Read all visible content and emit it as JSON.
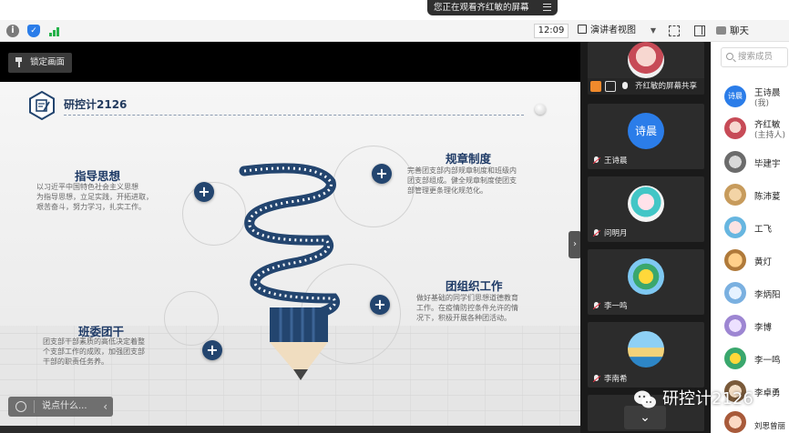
{
  "banner": {
    "viewing_text": "您正在观看齐红敏的屏幕"
  },
  "toolbar": {
    "time": "12:09",
    "view_mode": "演讲者视图",
    "chat_tab": "聊天"
  },
  "stage": {
    "lock_label": "锁定画面",
    "chat_placeholder": "说点什么..."
  },
  "slide": {
    "title": "研控计2126",
    "sections": {
      "guiding": {
        "title": "指导思想",
        "body_lines": [
          "以习近平中国特色社会主义思想",
          "为指导思想，立足实践，开拓进取，",
          "艰苦奋斗，努力学习，扎实工作。"
        ]
      },
      "rules": {
        "title": "规章制度",
        "body_lines": [
          "完善团支部内部规章制度和班级内",
          "团支部组成。健全规章制度使团支",
          "部管理更条理化规范化。"
        ]
      },
      "activities": {
        "title": "团组织工作",
        "body_lines": [
          "做好基础的同学们思想道德教育",
          "工作。在疫情防控条件允许的情",
          "况下，积极开展各种团活动。"
        ]
      },
      "committee": {
        "title": "班委团干",
        "body_lines": [
          "团支部干部素质的高低决定着整",
          "个支部工作的成败，加强团支部",
          "干部的职责任务养。"
        ]
      }
    }
  },
  "video_tiles": [
    {
      "name": "齐红敏的屏幕共享",
      "kind": "avatar-girl"
    },
    {
      "name": "王诗晨",
      "avatar_text": "诗晨",
      "kind": "text"
    },
    {
      "name": "问明月",
      "kind": "avatar-anime"
    },
    {
      "name": "李一鸣",
      "kind": "avatar-cartoon"
    },
    {
      "name": "李南希",
      "kind": "avatar-beach"
    }
  ],
  "members_panel": {
    "search_placeholder": "搜索成员",
    "members": [
      {
        "name": "王诗晨",
        "sub": "(我)",
        "avatar_text": "诗晨"
      },
      {
        "name": "齐红敏",
        "sub": "(主持人)"
      },
      {
        "name": "毕建宇"
      },
      {
        "name": "陈沛萲"
      },
      {
        "name": "工飞"
      },
      {
        "name": "黄灯"
      },
      {
        "name": "李炳阳"
      },
      {
        "name": "李博"
      },
      {
        "name": "李一鸣"
      },
      {
        "name": "李卓勇"
      },
      {
        "name": "刘思曾丽"
      }
    ]
  },
  "watermark": {
    "text": "研控计2126"
  },
  "colors": {
    "accent_blue": "#2b7de9",
    "slide_navy": "#23456f",
    "video_bg": "#1a1a1a"
  }
}
